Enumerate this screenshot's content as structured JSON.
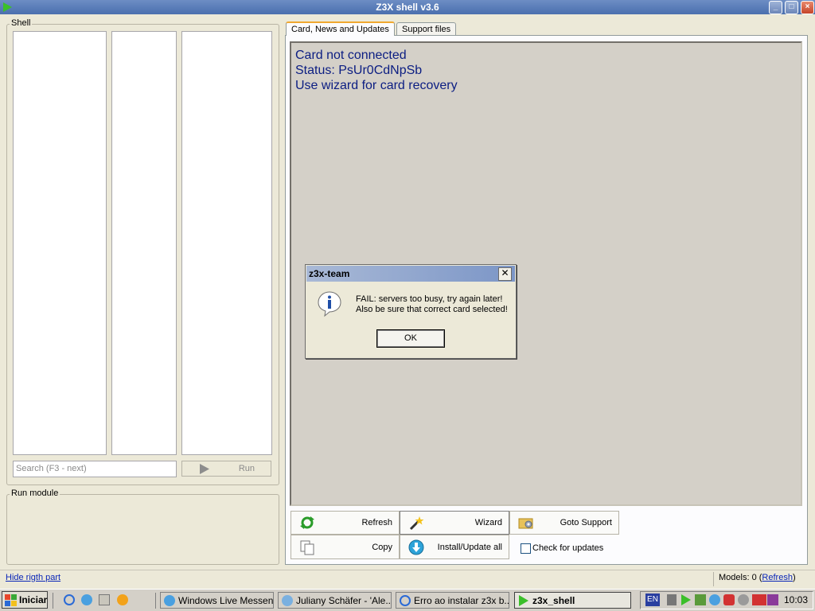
{
  "window": {
    "title": "Z3X shell v3.6"
  },
  "shell": {
    "label": "Shell",
    "search_placeholder": "Search (F3 - next)",
    "run_label": "Run"
  },
  "run_module": {
    "label": "Run module"
  },
  "tabs": [
    {
      "label": "Card, News and Updates"
    },
    {
      "label": "Support files"
    }
  ],
  "card": {
    "line1": "Card not connected",
    "line2": "Status: PsUr0CdNpSb",
    "line3": "Use wizard for card recovery"
  },
  "buttons": {
    "refresh": "Refresh",
    "wizard": "Wizard",
    "goto_support": "Goto Support",
    "copy": "Copy",
    "install_update": "Install/Update all",
    "check_updates": "Check for updates"
  },
  "dialog": {
    "title": "z3x-team",
    "message_line1": "FAIL: servers too busy, try again later!",
    "message_line2": "Also be sure that correct card selected!",
    "ok": "OK"
  },
  "statusbar": {
    "hide_link": "Hide rigth part",
    "models_prefix": "Models: 0 (",
    "refresh_link": "Refresh",
    "models_suffix": ")"
  },
  "taskbar": {
    "start": "Iniciar",
    "items": [
      {
        "label": "Windows Live Messen..."
      },
      {
        "label": "Juliany Schäfer  - 'Ale..."
      },
      {
        "label": "Erro ao instalar z3x b..."
      },
      {
        "label": "z3x_shell"
      }
    ],
    "lang": "EN",
    "clock": "10:03"
  }
}
